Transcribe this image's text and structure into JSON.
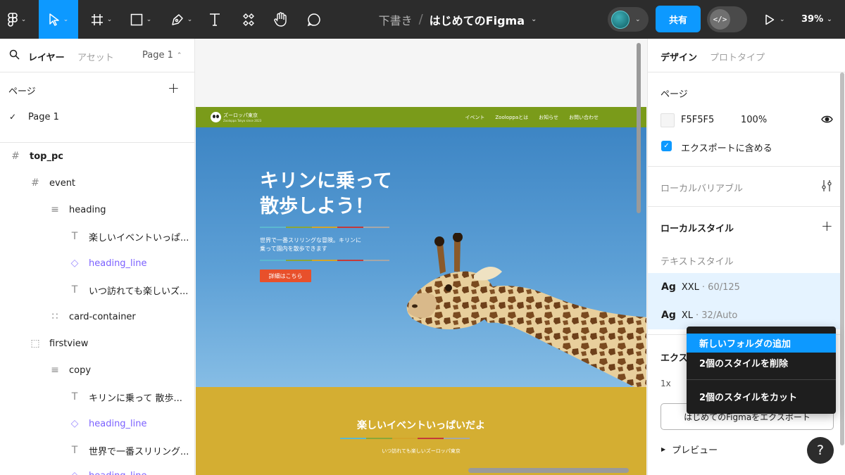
{
  "toolbar": {
    "breadcrumb_draft": "下書き",
    "breadcrumb_sep": "/",
    "file_name": "はじめてのFigma",
    "share_label": "共有",
    "zoom": "39%",
    "accent": "#0d99ff"
  },
  "left_panel": {
    "tab_layers": "レイヤー",
    "tab_assets": "アセット",
    "page_selector": "Page 1",
    "pages_heading": "ページ",
    "pages": [
      {
        "label": "Page 1",
        "selected": true
      }
    ],
    "layers": [
      {
        "label": "top_pc",
        "icon": "frame-icon"
      },
      {
        "label": "event",
        "icon": "frame-icon"
      },
      {
        "label": "heading",
        "icon": "auto-layout-icon"
      },
      {
        "label": "楽しいイベントいっぱ...",
        "icon": "text-icon"
      },
      {
        "label": "heading_line",
        "icon": "instance-icon"
      },
      {
        "label": "いつ訪れても楽しいズ...",
        "icon": "text-icon"
      },
      {
        "label": "card-container",
        "icon": "grid-icon"
      },
      {
        "label": "firstview",
        "icon": "group-icon"
      },
      {
        "label": "copy",
        "icon": "auto-layout-icon"
      },
      {
        "label": "キリンに乗って 散歩...",
        "icon": "text-icon"
      },
      {
        "label": "heading_line",
        "icon": "instance-icon"
      },
      {
        "label": "世界で一番スリリング...",
        "icon": "text-icon"
      },
      {
        "label": "heading_line",
        "icon": "instance-icon"
      }
    ]
  },
  "canvas": {
    "site": {
      "brand": "ズーロッパ東京",
      "brand_sub": "Zooloppa Tokyo since 2023",
      "nav": [
        "イベント",
        "Zooloppaとは",
        "お知らせ",
        "お問い合わせ"
      ],
      "hero_title_1": "キリンに乗って",
      "hero_title_2": "散歩しよう！",
      "hero_copy_1": "世界で一番スリリングな冒険。キリンに",
      "hero_copy_2": "乗って園内を散歩できます",
      "hero_button": "詳細はこちら",
      "event_title": "楽しいイベントいっぱいだよ",
      "event_sub": "いつ訪れても楽しいズーロッパ東京"
    },
    "line_colors": [
      "#5bb8d0",
      "#8aa63a",
      "#d4a52a",
      "#c43a3a",
      "#a7a7a7"
    ]
  },
  "right_panel": {
    "tab_design": "デザイン",
    "tab_prototype": "プロトタイプ",
    "page_section": "ページ",
    "bg_hex": "F5F5F5",
    "bg_opacity": "100%",
    "include_export_label": "エクスポートに含める",
    "local_variables": "ローカルバリアブル",
    "local_styles": "ローカルスタイル",
    "text_styles_heading": "テキストスタイル",
    "text_styles": [
      {
        "ag": "Ag",
        "name": "XXL",
        "meta": "· 60/125"
      },
      {
        "ag": "Ag",
        "name": "XL",
        "meta": "· 32/Auto"
      }
    ],
    "export_heading": "エクスポート",
    "export_scale": "1x",
    "export_button": "はじめてのFigmaをエクスポート",
    "preview_label": "プレビュー"
  },
  "context_menu": {
    "items": [
      "新しいフォルダの追加",
      "2個のスタイルを削除",
      "2個のスタイルをカット"
    ]
  },
  "help_label": "?"
}
